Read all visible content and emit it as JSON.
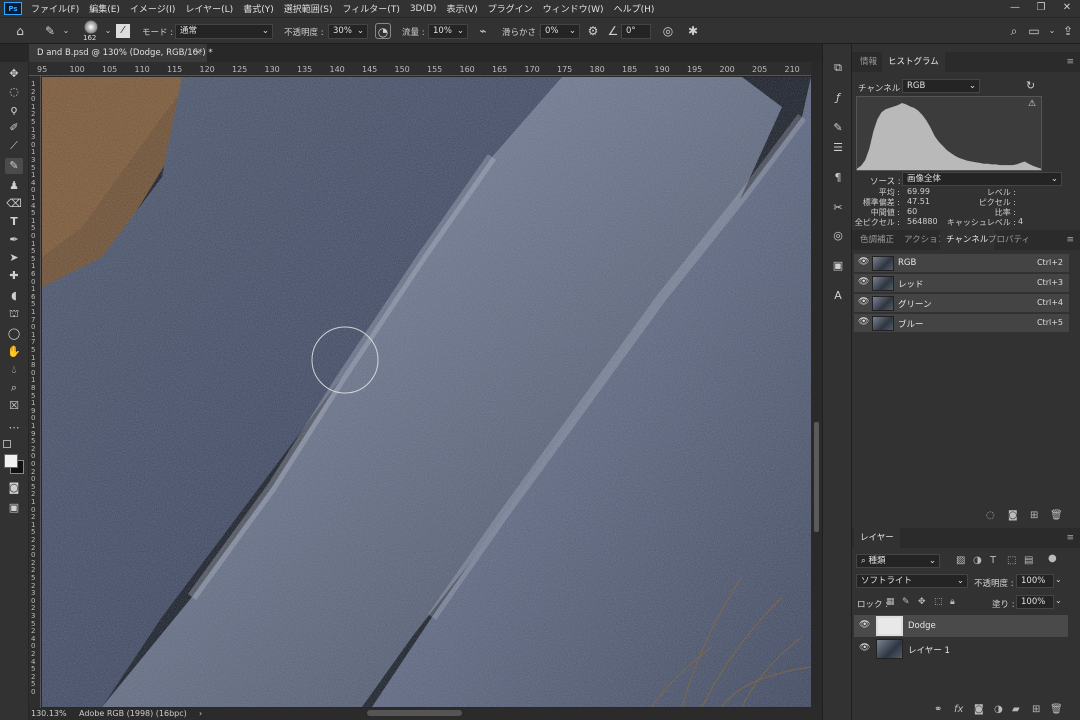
{
  "menubar": {
    "logo": "Ps",
    "items": [
      "ファイル(F)",
      "編集(E)",
      "イメージ(I)",
      "レイヤー(L)",
      "書式(Y)",
      "選択範囲(S)",
      "フィルター(T)",
      "3D(D)",
      "表示(V)",
      "プラグイン",
      "ウィンドウ(W)",
      "ヘルプ(H)"
    ],
    "window_controls": [
      "—",
      "❐",
      "✕"
    ]
  },
  "options": {
    "brush_size": "162",
    "mode_label": "モード :",
    "mode_value": "通常",
    "opacity_label": "不透明度 :",
    "opacity_value": "30%",
    "flow_label": "流量 :",
    "flow_value": "10%",
    "smoothing_label": "滑らかさ :",
    "smoothing_value": "0%",
    "angle_value": "0°"
  },
  "document": {
    "tab_title": "D and B.psd @ 130% (Dodge, RGB/16*) *",
    "close": "×"
  },
  "ruler": {
    "h_ticks": [
      "95",
      "100",
      "105",
      "110",
      "115",
      "120",
      "125",
      "130",
      "135",
      "140",
      "145",
      "150",
      "155",
      "160",
      "165",
      "170",
      "175",
      "180",
      "185",
      "190",
      "195",
      "200",
      "205",
      "210"
    ],
    "v_ticks": [
      "1",
      "2",
      "0",
      "1",
      "2",
      "5",
      "1",
      "3",
      "0",
      "1",
      "3",
      "5",
      "1",
      "4",
      "0",
      "1",
      "4",
      "5",
      "1",
      "5",
      "0",
      "1",
      "5",
      "5",
      "1",
      "6",
      "0",
      "1",
      "6",
      "5",
      "1",
      "7",
      "0",
      "1",
      "7",
      "5",
      "1",
      "8",
      "0",
      "1",
      "8",
      "5",
      "1",
      "9",
      "0",
      "1",
      "9",
      "5",
      "2",
      "0",
      "0",
      "2",
      "0",
      "5",
      "2",
      "1",
      "0",
      "2",
      "1",
      "5",
      "2",
      "2",
      "0",
      "2",
      "2",
      "5",
      "2",
      "3",
      "0",
      "2",
      "3",
      "5",
      "2",
      "4",
      "0",
      "2",
      "4",
      "5",
      "2",
      "5",
      "0"
    ]
  },
  "status": {
    "zoom": "130.13%",
    "profile": "Adobe RGB (1998) (16bpc)",
    "arrow": "›"
  },
  "info_panel": {
    "tabs": [
      "情報",
      "ヒストグラム"
    ],
    "channel_label": "チャンネル :",
    "channel_value": "RGB",
    "source_label": "ソース :",
    "source_value": "画像全体",
    "stats_left": [
      {
        "k": "平均 :",
        "v": "69.99"
      },
      {
        "k": "標準偏差 :",
        "v": "47.51"
      },
      {
        "k": "中間値 :",
        "v": "60"
      },
      {
        "k": "全ピクセル :",
        "v": "564880"
      }
    ],
    "stats_right": [
      {
        "k": "レベル :",
        "v": ""
      },
      {
        "k": "ピクセル :",
        "v": ""
      },
      {
        "k": "比率 :",
        "v": ""
      },
      {
        "k": "キャッシュレベル :",
        "v": "4"
      }
    ]
  },
  "channels_panel": {
    "tabs": [
      "色調補正",
      "アクション",
      "チャンネル",
      "プロパティ"
    ],
    "rows": [
      {
        "name": "RGB",
        "shortcut": "Ctrl+2"
      },
      {
        "name": "レッド",
        "shortcut": "Ctrl+3"
      },
      {
        "name": "グリーン",
        "shortcut": "Ctrl+4"
      },
      {
        "name": "ブルー",
        "shortcut": "Ctrl+5"
      }
    ]
  },
  "layers_panel": {
    "tab": "レイヤー",
    "filter_value": "種類",
    "blend_value": "ソフトライト",
    "opacity_label": "不透明度 :",
    "opacity_value": "100%",
    "lock_label": "ロック :",
    "fill_label": "塗り :",
    "fill_value": "100%",
    "layers": [
      {
        "name": "Dodge",
        "selected": true
      },
      {
        "name": "レイヤー 1",
        "selected": false
      }
    ]
  },
  "colors": {
    "ps_blue": "#31a8ff",
    "panel_bg": "#323232",
    "canvas_rock": "#5b6476"
  },
  "histogram": {
    "bins": [
      2,
      6,
      14,
      30,
      55,
      72,
      82,
      86,
      88,
      90,
      92,
      95,
      93,
      90,
      88,
      84,
      78,
      70,
      60,
      48,
      40,
      34,
      28,
      24,
      20,
      17,
      15,
      13,
      12,
      11,
      10,
      9,
      9,
      8,
      8,
      7,
      7,
      7,
      7,
      8,
      10,
      12,
      9,
      6,
      4,
      2
    ]
  }
}
